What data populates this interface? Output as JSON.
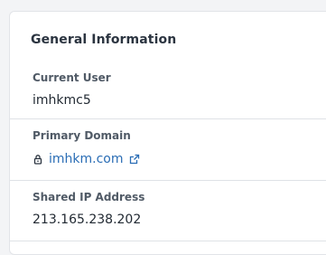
{
  "card": {
    "title": "General Information"
  },
  "current_user": {
    "label": "Current User",
    "value": "imhkmc5"
  },
  "primary_domain": {
    "label": "Primary Domain",
    "value": "imhkm.com",
    "lock_icon": "lock-icon",
    "external_icon": "external-link-icon"
  },
  "shared_ip": {
    "label": "Shared IP Address",
    "value": "213.165.238.202"
  },
  "colors": {
    "link": "#2a6db5",
    "title": "#2b3440",
    "label": "#505a66",
    "divider": "#dfe2e6"
  }
}
